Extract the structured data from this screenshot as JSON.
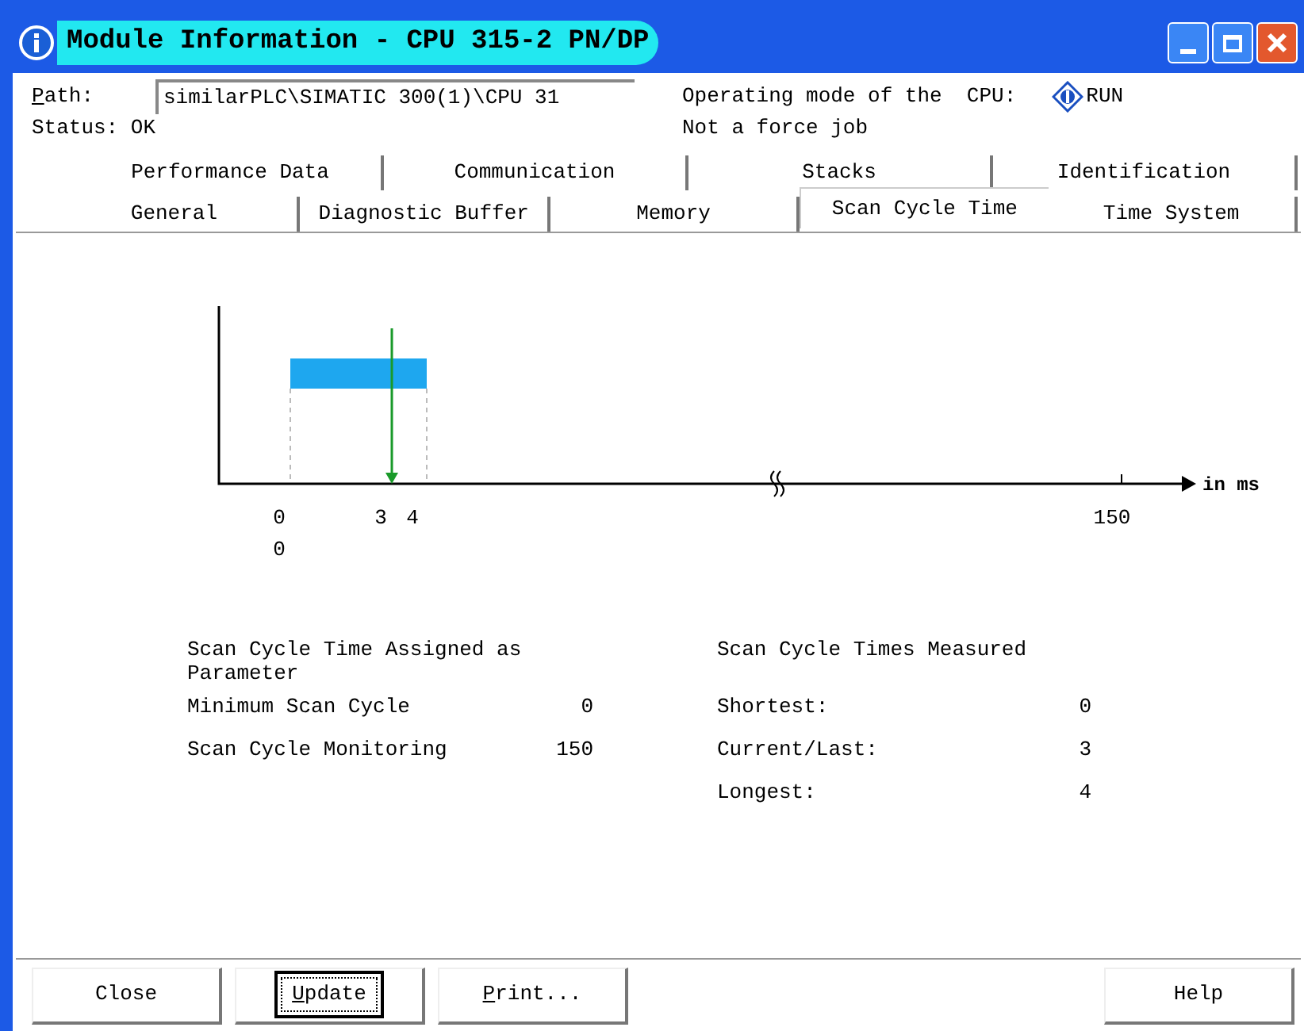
{
  "window": {
    "title": "Module Information - CPU 315-2 PN/DP"
  },
  "header": {
    "path_label": "Path:",
    "path_value": "similarPLC\\SIMATIC 300(1)\\CPU 31",
    "mode_label": "Operating mode of the  CPU:",
    "mode_value": "RUN",
    "status": "Status: OK",
    "force": "Not a force job"
  },
  "tab_rows": [
    [
      {
        "label": "Performance Data",
        "selected": false
      },
      {
        "label": "Communication",
        "selected": false
      },
      {
        "label": "Stacks",
        "selected": false
      },
      {
        "label": "Identification",
        "selected": false
      }
    ],
    [
      {
        "label": "General",
        "selected": false
      },
      {
        "label": "Diagnostic Buffer",
        "selected": false
      },
      {
        "label": "Memory",
        "selected": false
      },
      {
        "label": "Scan Cycle Time",
        "selected": true
      },
      {
        "label": "Time System",
        "selected": false
      }
    ]
  ],
  "diagram": {
    "tick_labels": [
      "0",
      "3",
      "4",
      "150"
    ],
    "extra_label": "0",
    "axis_unit": "in ms"
  },
  "assigned": {
    "title": "Scan Cycle Time Assigned as Parameter",
    "rows": [
      {
        "label": "Minimum Scan Cycle",
        "value": "0"
      },
      {
        "label": "Scan Cycle Monitoring",
        "value": "150"
      }
    ]
  },
  "measured": {
    "title": "Scan Cycle Times Measured",
    "rows": [
      {
        "label": "Shortest:",
        "value": "0"
      },
      {
        "label": "Current/Last:",
        "value": "3"
      },
      {
        "label": "Longest:",
        "value": "4"
      }
    ]
  },
  "buttons": [
    {
      "label": "Close",
      "focused": false
    },
    {
      "label": "Update",
      "focused": true
    },
    {
      "label": "Print...",
      "focused": false
    },
    {
      "label": "Help",
      "focused": false
    }
  ]
}
